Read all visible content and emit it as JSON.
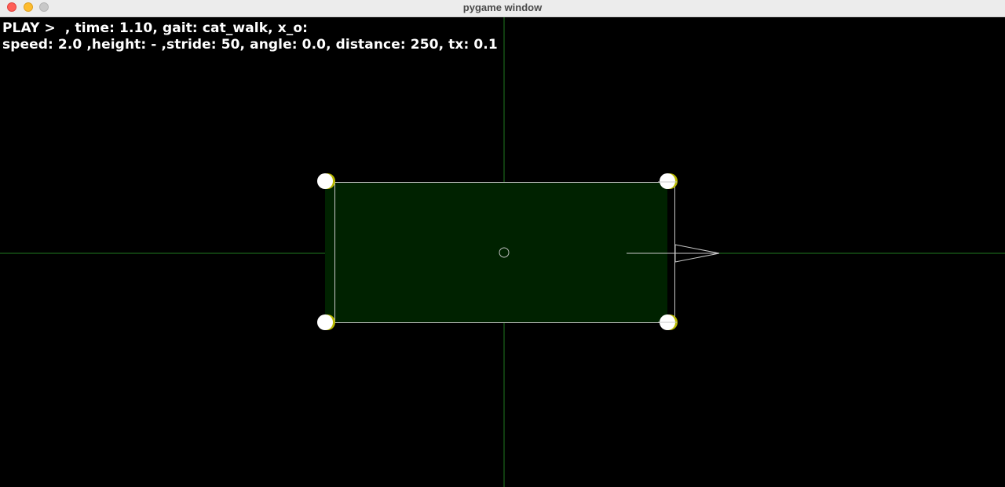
{
  "window": {
    "title": "pygame window"
  },
  "hud": {
    "line1": "PLAY >  , time: 1.10, gait: cat_walk, x_o:",
    "line2": "speed: 2.0 ,height: - ,stride: 50, angle: 0.0, distance: 250, tx: 0.1"
  },
  "colors": {
    "background": "#000000",
    "axis": "#1f8a1f",
    "body_fill": "#002200",
    "body_outline": "#c8c8c8",
    "foot": "#ffffff",
    "foot_shadow": "#c8c800",
    "direction_arrow": "#c8c8c8"
  },
  "icons": {
    "close": "close-traffic-light-icon",
    "minimize": "minimize-traffic-light-icon",
    "zoom": "zoom-traffic-light-icon",
    "center_marker": "center-circle-icon",
    "heading_arrow": "arrow-right-icon"
  }
}
